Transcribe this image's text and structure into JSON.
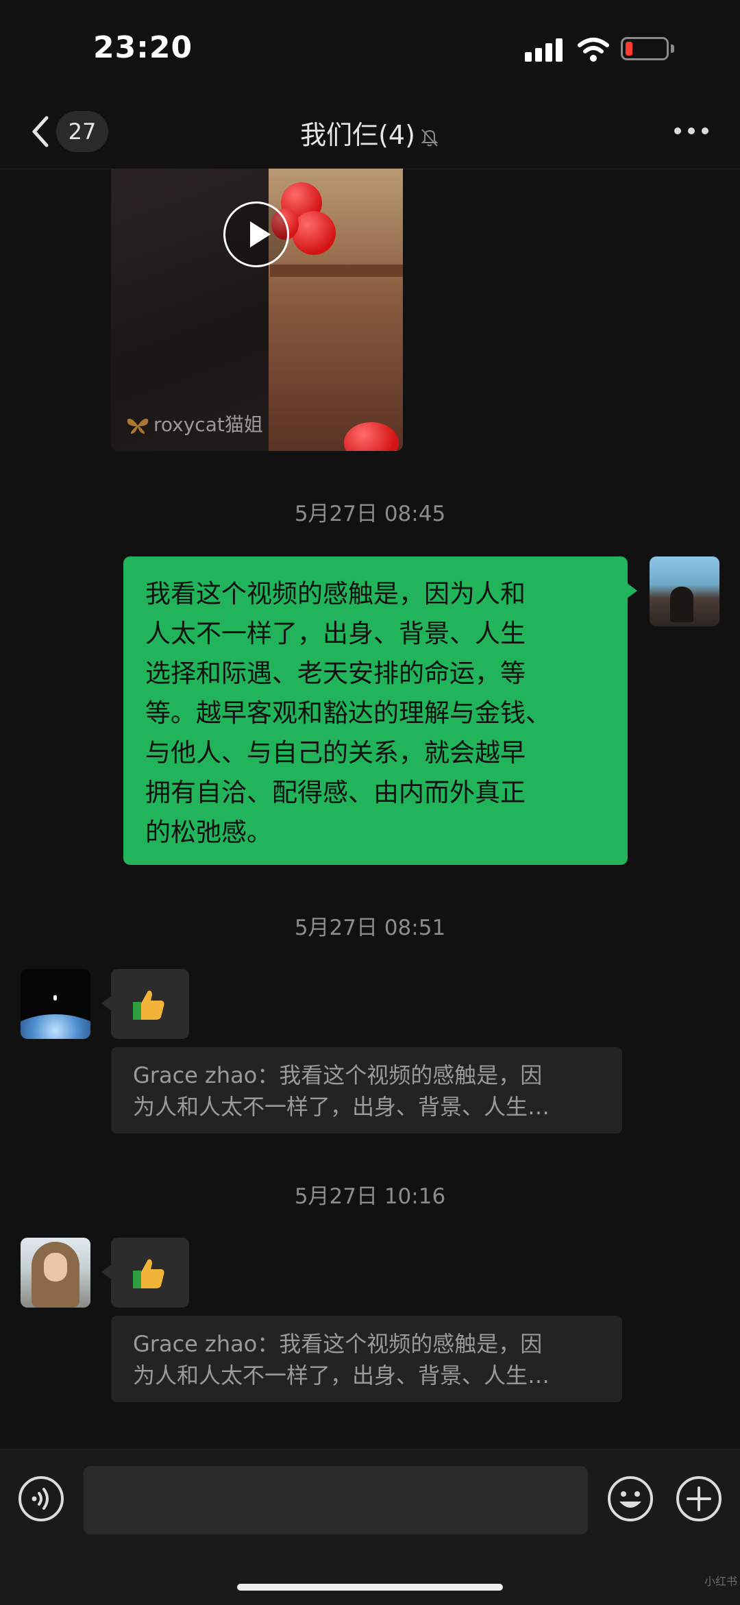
{
  "status_bar": {
    "time": "23:20"
  },
  "nav": {
    "unread_count": "27",
    "title": "我们仨(4)"
  },
  "video": {
    "watermark": "roxycat猫姐"
  },
  "messages": {
    "ts1": "5月27日 08:45",
    "self_lines": [
      "我看这个视频的感触是，因为人和",
      "人太不一样了，出身、背景、人生",
      "选择和际遇、老天安排的命运，等",
      "等。越早客观和豁达的理解与金钱、",
      "与他人、与自己的关系，就会越早",
      "拥有自洽、配得感、由内而外真正",
      "的松弛感。"
    ],
    "ts2": "5月27日 08:51",
    "ts3": "5月27日 10:16",
    "quote1": [
      "Grace zhao：我看这个视频的感触是，因",
      "为人和人太不一样了，出身、背景、人生…"
    ],
    "quote2": [
      "Grace zhao：我看这个视频的感触是，因",
      "为人和人太不一样了，出身、背景、人生…"
    ]
  },
  "input": {
    "placeholder": ""
  },
  "corner_mark": "小红书"
}
